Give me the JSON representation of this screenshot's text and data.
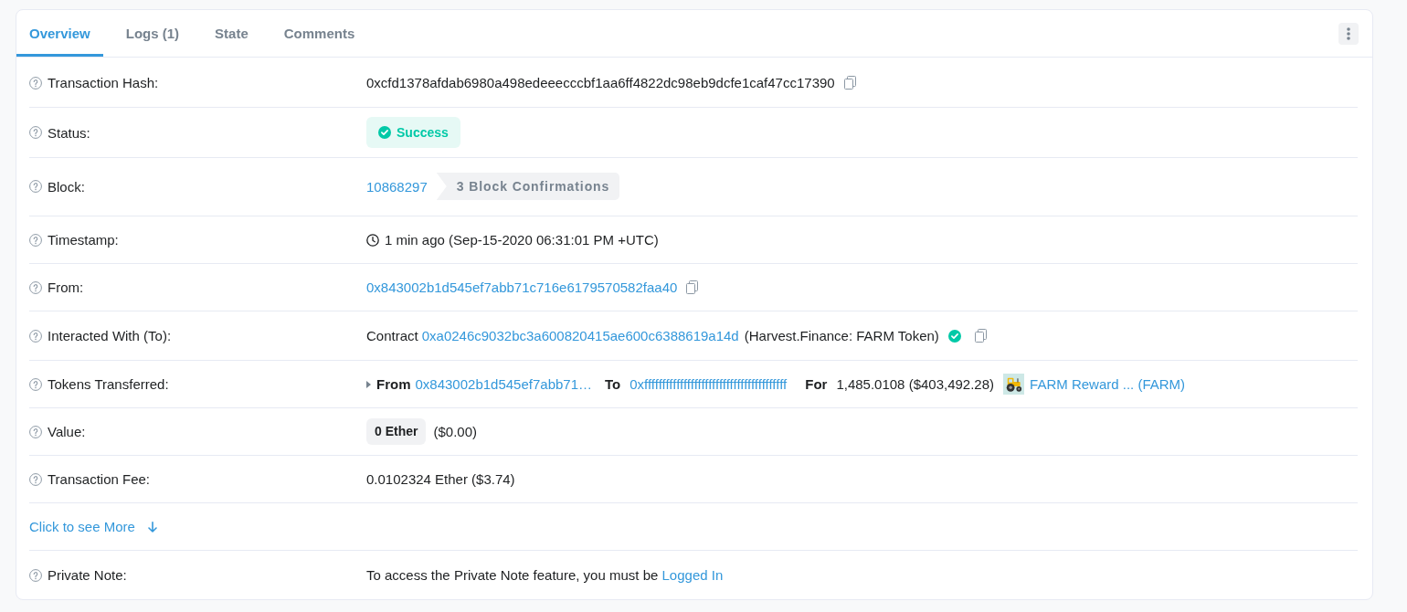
{
  "tabs": [
    {
      "label": "Overview",
      "selected": true
    },
    {
      "label": "Logs (1)",
      "selected": false
    },
    {
      "label": "State",
      "selected": false
    },
    {
      "label": "Comments",
      "selected": false
    }
  ],
  "rows": [
    {
      "kind": "hash",
      "label": "Transaction Hash:",
      "value": "0xcfd1378afdab6980a498edeeecccbf1aa6ff4822dc98eb9dcfe1caf47cc17390"
    },
    {
      "kind": "status",
      "label": "Status:",
      "badge": "Success"
    },
    {
      "kind": "block",
      "label": "Block:",
      "link": "10868297",
      "confirmations": "3 Block Confirmations"
    },
    {
      "kind": "timestamp",
      "label": "Timestamp:",
      "value": "1 min ago (Sep-15-2020 06:31:01 PM +UTC)"
    },
    {
      "kind": "address",
      "label": "From:",
      "link": "0x843002b1d545ef7abb71c716e6179570582faa40"
    },
    {
      "kind": "contract",
      "label": "Interacted With (To):",
      "prefix": "Contract",
      "link": "0xa0246c9032bc3a600820415ae600c6388619a14d",
      "name": "(Harvest.Finance: FARM Token)",
      "verified": true
    },
    {
      "kind": "tokens",
      "label": "Tokens Transferred:",
      "transfers": [
        {
          "from_label": "From",
          "from": "0x843002b1d545ef7abb71…",
          "to_label": "To",
          "to": "0xffffffffffffffffffffffffffffffffffffffff",
          "for_label": "For",
          "amount": "1,485.0108 ($403,492.28)",
          "token": "FARM Reward ... (FARM)"
        }
      ]
    },
    {
      "kind": "value",
      "label": "Value:",
      "badge": "0 Ether",
      "usd": "($0.00)"
    },
    {
      "kind": "text",
      "label": "Transaction Fee:",
      "value": "0.0102324 Ether ($3.74)"
    },
    {
      "kind": "more",
      "link": "Click to see More"
    },
    {
      "kind": "note",
      "label": "Private Note:",
      "text": "To access the Private Note feature, you must be",
      "link": "Logged In"
    }
  ]
}
